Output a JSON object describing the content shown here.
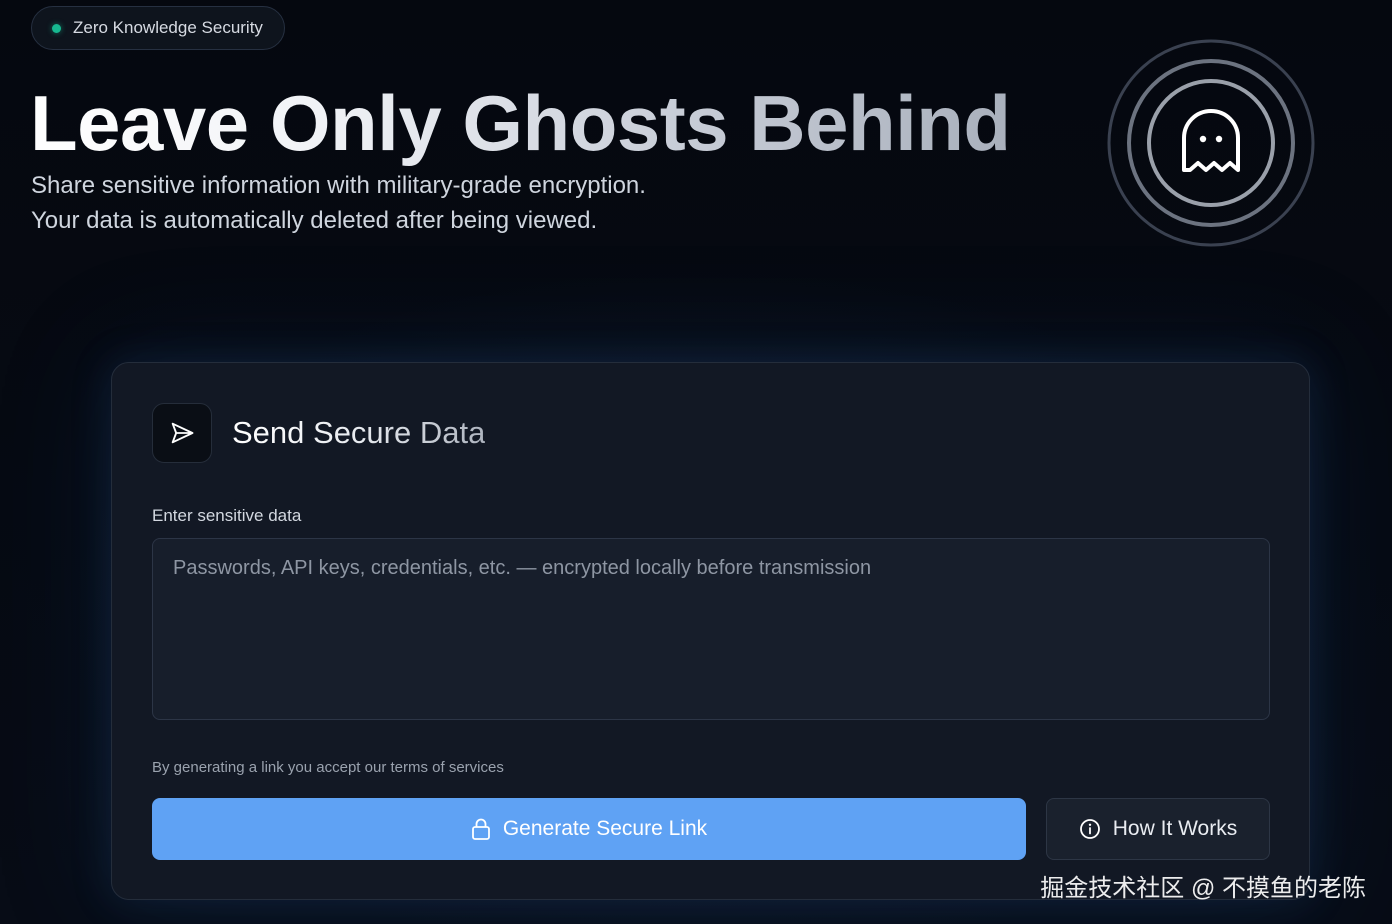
{
  "badge": {
    "label": "Zero Knowledge Security",
    "dot_color": "#17b890"
  },
  "hero": {
    "title": "Leave Only Ghosts Behind",
    "subtitle_lines": [
      "Share sensitive information with military-grade encryption.",
      "Your data is automatically deleted after being viewed."
    ],
    "emblem_icon": "ghost-icon"
  },
  "card": {
    "icon": "send-icon",
    "title": "Send Secure Data",
    "field_label": "Enter sensitive data",
    "textarea": {
      "value": "",
      "placeholder": "Passwords, API keys, credentials, etc. — encrypted locally before transmission"
    },
    "terms_text": "By generating a link you accept our terms of services",
    "primary_button": {
      "icon": "lock-icon",
      "label": "Generate Secure Link",
      "color": "#5fa2f4"
    },
    "secondary_button": {
      "icon": "info-icon",
      "label": "How It Works"
    }
  },
  "watermark": "掘金技术社区 @ 不摸鱼的老陈",
  "colors": {
    "background": "#060a12",
    "card": "#121824",
    "accent": "#5fa2f4"
  }
}
